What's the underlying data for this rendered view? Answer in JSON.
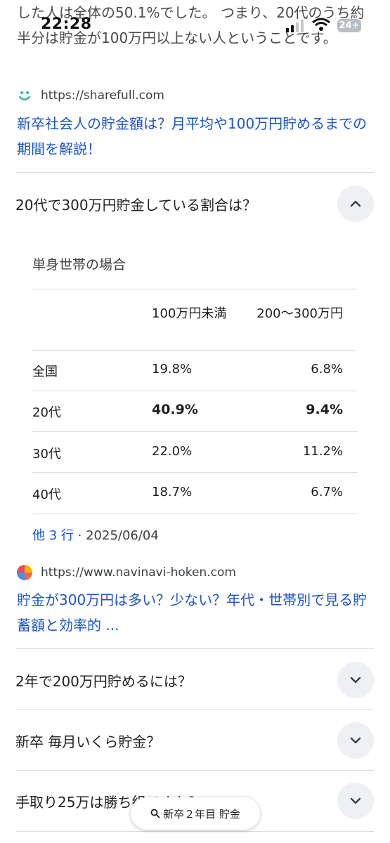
{
  "status_bar": {
    "time": "22:28",
    "battery": "24+"
  },
  "snippet": {
    "text": "した人は全体の50.1%でした。 つまり、20代のうち約半分は貯金が100万円以上ない人ということです。"
  },
  "result1": {
    "url": "https://sharefull.com",
    "title": "新卒社会人の貯金額は？月平均や100万円貯めるまでの期間を解説！",
    "logo_color": "#2fb8a8"
  },
  "faq_open": {
    "question": "20代で300万円貯金している割合は？",
    "heading": "単身世帯の場合",
    "columns": [
      "",
      "100万円未満",
      "200～300万円"
    ],
    "rows": [
      {
        "label": "全国",
        "col1": "19.8%",
        "col2": "6.8%",
        "bold": false
      },
      {
        "label": "20代",
        "col1": "40.9%",
        "col2": "9.4%",
        "bold": true
      },
      {
        "label": "30代",
        "col1": "22.0%",
        "col2": "11.2%",
        "bold": false
      },
      {
        "label": "40代",
        "col1": "18.7%",
        "col2": "6.7%",
        "bold": false
      }
    ],
    "more_rows": "他 3 行",
    "date": "2025/06/04"
  },
  "result2": {
    "url": "https://www.navinavi-hoken.com",
    "title": "貯金が300万円は多い？少ない？年代・世帯別で見る貯蓄額と効率的 ..."
  },
  "faq_closed": [
    {
      "question": "2年で200万円貯めるには？"
    },
    {
      "question": "新卒 毎月いくら貯金？"
    },
    {
      "question": "手取り25万は勝ち組ですか？"
    }
  ],
  "search_pill": {
    "query": "新卒２年目 貯金"
  },
  "colors": {
    "link": "#1a55c9",
    "divider": "#dadce0",
    "chevron_bg": "#eef0f3"
  }
}
